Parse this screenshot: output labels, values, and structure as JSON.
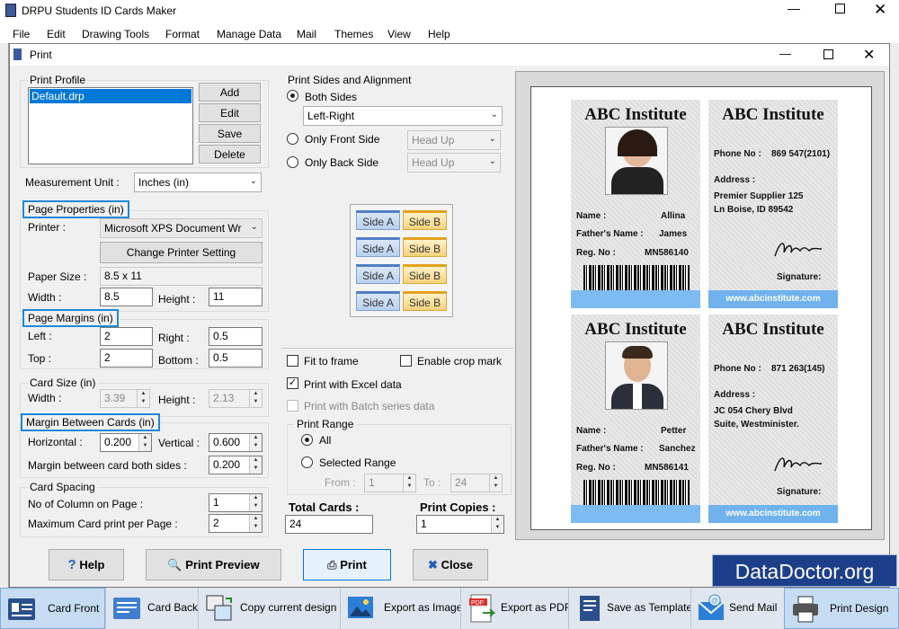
{
  "app": {
    "title": "DRPU Students ID Cards Maker",
    "menu": [
      "File",
      "Edit",
      "Drawing Tools",
      "Format",
      "Manage Data",
      "Mail",
      "Themes",
      "View",
      "Help"
    ]
  },
  "dialog": {
    "title": "Print",
    "print_profile": {
      "label": "Print Profile",
      "items": [
        "Default.drp"
      ],
      "buttons": {
        "add": "Add",
        "edit": "Edit",
        "save": "Save",
        "delete": "Delete"
      }
    },
    "measurement": {
      "label": "Measurement Unit :",
      "value": "Inches (in)"
    },
    "page_properties": {
      "label": "Page Properties (in)",
      "printer_label": "Printer :",
      "printer_value": "Microsoft XPS Document Wr",
      "change_btn": "Change Printer Setting",
      "paper_size_label": "Paper Size :",
      "paper_size_value": "8.5 x 11",
      "width_label": "Width :",
      "width_value": "8.5",
      "height_label": "Height :",
      "height_value": "11"
    },
    "page_margins": {
      "label": "Page Margins (in)",
      "left_label": "Left :",
      "left_value": "2",
      "right_label": "Right :",
      "right_value": "0.5",
      "top_label": "Top :",
      "top_value": "2",
      "bottom_label": "Bottom :",
      "bottom_value": "0.5"
    },
    "card_size": {
      "label": "Card Size (in)",
      "width_label": "Width :",
      "width_value": "3.39",
      "height_label": "Height :",
      "height_value": "2.13"
    },
    "margin_between": {
      "label": "Margin Between Cards (in)",
      "horizontal_label": "Horizontal :",
      "horizontal_value": "0.200",
      "vertical_label": "Vertical :",
      "vertical_value": "0.600",
      "both_label": "Margin between card both sides :",
      "both_value": "0.200"
    },
    "card_spacing": {
      "label": "Card Spacing",
      "columns_label": "No of Column on Page :",
      "columns_value": "1",
      "max_label": "Maximum Card print per Page :",
      "max_value": "2"
    },
    "sides": {
      "label": "Print Sides and Alignment",
      "both": "Both Sides",
      "alignment": "Left-Right",
      "front": "Only Front Side",
      "front_value": "Head Up",
      "back": "Only Back Side",
      "back_value": "Head Up",
      "side_a": "Side A",
      "side_b": "Side B"
    },
    "options": {
      "fit": "Fit to frame",
      "crop": "Enable crop mark",
      "excel": "Print with Excel data",
      "batch": "Print with Batch series data"
    },
    "range": {
      "label": "Print Range",
      "all": "All",
      "selected": "Selected Range",
      "from_label": "From :",
      "from_value": "1",
      "to_label": "To :",
      "to_value": "24"
    },
    "totals": {
      "total_label": "Total Cards :",
      "total_value": "24",
      "copies_label": "Print Copies :",
      "copies_value": "1"
    },
    "buttons": {
      "help": "Help",
      "preview": "Print Preview",
      "print": "Print",
      "close": "Close"
    }
  },
  "preview": {
    "cards": [
      {
        "institute": "ABC Institute",
        "name_label": "Name :",
        "name": "Allina",
        "father_label": "Father's Name :",
        "father": "James",
        "reg_label": "Reg. No :",
        "reg": "MN586140"
      },
      {
        "institute": "ABC Institute",
        "phone_label": "Phone No :",
        "phone": "869 547(2101)",
        "address_label": "Address :",
        "address1": "Premier Supplier 125",
        "address2": "Ln Boise, ID 89542",
        "signature_label": "Signature:",
        "website": "www.abcinstitute.com"
      },
      {
        "institute": "ABC Institute",
        "name_label": "Name :",
        "name": "Petter",
        "father_label": "Father's Name :",
        "father": "Sanchez",
        "reg_label": "Reg. No :",
        "reg": "MN586141"
      },
      {
        "institute": "ABC Institute",
        "phone_label": "Phone No :",
        "phone": "871 263(145)",
        "address_label": "Address :",
        "address1": "JC 054 Chery Blvd",
        "address2": "Suite, Westminister.",
        "signature_label": "Signature:",
        "website": "www.abcinstitute.com"
      }
    ]
  },
  "watermark": "DataDoctor.org",
  "toolbar": [
    {
      "label": "Card Front",
      "icon": "card-front-icon"
    },
    {
      "label": "Card Back",
      "icon": "card-back-icon"
    },
    {
      "label": "Copy current design",
      "icon": "copy-design-icon"
    },
    {
      "label": "Export as Image",
      "icon": "export-image-icon"
    },
    {
      "label": "Export as PDF",
      "icon": "pdf-icon"
    },
    {
      "label": "Save as Template",
      "icon": "template-icon"
    },
    {
      "label": "Send Mail",
      "icon": "mail-icon"
    },
    {
      "label": "Print Design",
      "icon": "printer-icon"
    }
  ],
  "colors": {
    "accent": "#1e88d6",
    "card_footer": "#6fb2ee",
    "watermark_bg": "#1d3f8a"
  }
}
